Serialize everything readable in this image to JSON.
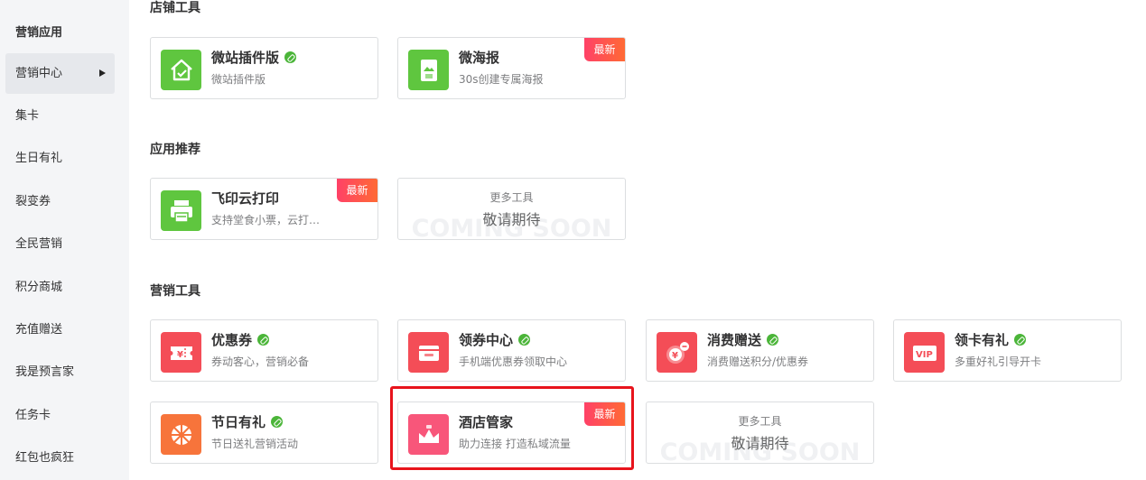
{
  "sidebar": {
    "heading": "营销应用",
    "items": [
      {
        "label": "营销中心",
        "active": true
      },
      {
        "label": "集卡"
      },
      {
        "label": "生日有礼"
      },
      {
        "label": "裂变券"
      },
      {
        "label": "全民营销"
      },
      {
        "label": "积分商城"
      },
      {
        "label": "充值赠送"
      },
      {
        "label": "我是预言家"
      },
      {
        "label": "任务卡"
      },
      {
        "label": "红包也疯狂"
      }
    ]
  },
  "sections": {
    "shop_tools": {
      "title": "店铺工具",
      "cards": [
        {
          "name": "微站插件版",
          "desc": "微站插件版",
          "icon": "home-icon",
          "color": "#5fc63f"
        },
        {
          "name": "微海报",
          "desc": "30s创建专属海报",
          "icon": "poster-icon",
          "color": "#5fc63f",
          "badge": "最新"
        }
      ]
    },
    "recommended": {
      "title": "应用推荐",
      "cards": [
        {
          "name": "飞印云打印",
          "desc": "支持堂食小票，云打…",
          "icon": "printer-icon",
          "color": "#5fc63f",
          "badge": "最新"
        }
      ],
      "more": {
        "sub": "更多工具",
        "main": "敬请期待",
        "watermark": "COMING SOON"
      }
    },
    "marketing_tools": {
      "title": "营销工具",
      "cards": [
        {
          "name": "优惠券",
          "desc": "券动客心，营销必备",
          "icon": "coupon-icon",
          "color": "#f44d57"
        },
        {
          "name": "领券中心",
          "desc": "手机端优惠券领取中心",
          "icon": "wallet-icon",
          "color": "#f44d57"
        },
        {
          "name": "消费赠送",
          "desc": "消费赠送积分/优惠券",
          "icon": "gift-coin-icon",
          "color": "#f44d57"
        },
        {
          "name": "领卡有礼",
          "desc": "多重好礼引导开卡",
          "icon": "vip-card-icon",
          "color": "#f44d57"
        },
        {
          "name": "节日有礼",
          "desc": "节日送礼营销活动",
          "icon": "wheel-icon",
          "color": "#f7743b"
        },
        {
          "name": "酒店管家",
          "desc": "助力连接 打造私域流量",
          "icon": "hotel-icon",
          "color": "#f8567a",
          "badge": "最新"
        }
      ],
      "more": {
        "sub": "更多工具",
        "main": "敬请期待",
        "watermark": "COMING SOON"
      }
    }
  },
  "colors": {
    "accent_green": "#5fc63f",
    "accent_red": "#f44d57",
    "highlight": "#e8141c"
  }
}
